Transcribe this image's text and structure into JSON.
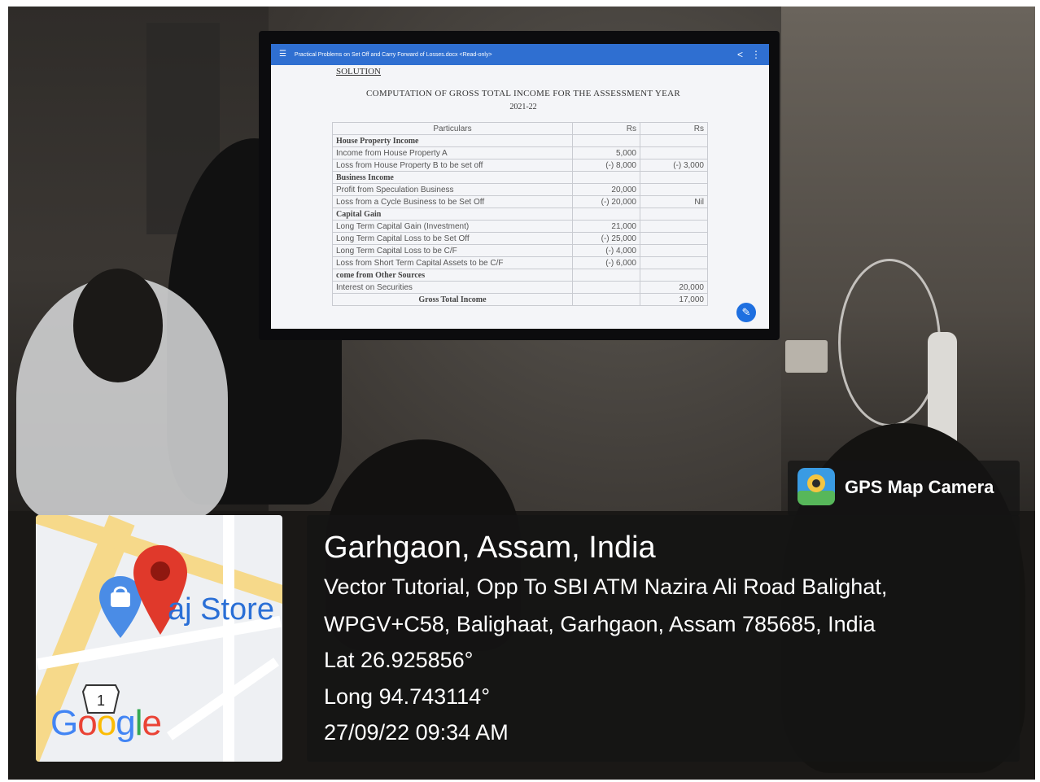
{
  "screen": {
    "tab_title": "Practical Problems on Set Off and Carry Forward of Losses.docx <Read-only>",
    "solution_heading": "SOLUTION",
    "title": "COMPUTATION OF GROSS TOTAL INCOME FOR THE ASSESSMENT YEAR",
    "year": "2021-22",
    "table": {
      "headers": [
        "Particulars",
        "Rs",
        "Rs"
      ],
      "rows": [
        {
          "label": "House Property Income",
          "c2": "",
          "c3": "",
          "kind": "head"
        },
        {
          "label": "Income from House Property A",
          "c2": "5,000",
          "c3": "",
          "kind": "item"
        },
        {
          "label": "Loss from House Property B to be set off",
          "c2": "(-) 8,000",
          "c3": "(-) 3,000",
          "kind": "item"
        },
        {
          "label": "Business Income",
          "c2": "",
          "c3": "",
          "kind": "head"
        },
        {
          "label": "Profit from Speculation Business",
          "c2": "20,000",
          "c3": "",
          "kind": "item"
        },
        {
          "label": "Loss from a Cycle Business to be Set Off",
          "c2": "(-) 20,000",
          "c3": "Nil",
          "kind": "item"
        },
        {
          "label": "Capital Gain",
          "c2": "",
          "c3": "",
          "kind": "head"
        },
        {
          "label": "Long Term Capital Gain (Investment)",
          "c2": "21,000",
          "c3": "",
          "kind": "item"
        },
        {
          "label": "Long Term Capital Loss to be Set Off",
          "c2": "(-) 25,000",
          "c3": "",
          "kind": "item"
        },
        {
          "label": "Long Term Capital Loss to be C/F",
          "c2": "(-) 4,000",
          "c3": "",
          "kind": "item"
        },
        {
          "label": "Loss from Short Term Capital Assets to be C/F",
          "c2": "(-) 6,000",
          "c3": "",
          "kind": "item"
        },
        {
          "label": "come from Other Sources",
          "c2": "",
          "c3": "",
          "kind": "head"
        },
        {
          "label": "Interest on Securities",
          "c2": "",
          "c3": "20,000",
          "kind": "item"
        },
        {
          "label": "Gross Total Income",
          "c2": "",
          "c3": "17,000",
          "kind": "total"
        }
      ]
    }
  },
  "map": {
    "place_label": "aj Store",
    "route_number": "1",
    "logo_text": "Google"
  },
  "overlay": {
    "app_name": "GPS Map Camera",
    "location_title": "Garhgaon, Assam, India",
    "address_line1": "Vector Tutorial, Opp To SBI ATM Nazira Ali Road Balighat,",
    "address_line2": "WPGV+C58, Balighaat, Garhgaon, Assam 785685, India",
    "latitude": "Lat 26.925856°",
    "longitude": "Long 94.743114°",
    "datetime": "27/09/22 09:34 AM"
  },
  "colors": {
    "screen_bar": "#2f6fd1",
    "map_pin": "#e0392b",
    "map_label": "#2a6fd6",
    "overlay_bg": "#141414"
  },
  "icons": [
    "menu-icon",
    "share-icon",
    "more-icon",
    "edit-icon",
    "map-pin-icon",
    "shopping-bag-pin-icon",
    "route-shield-icon",
    "gps-camera-app-icon"
  ]
}
